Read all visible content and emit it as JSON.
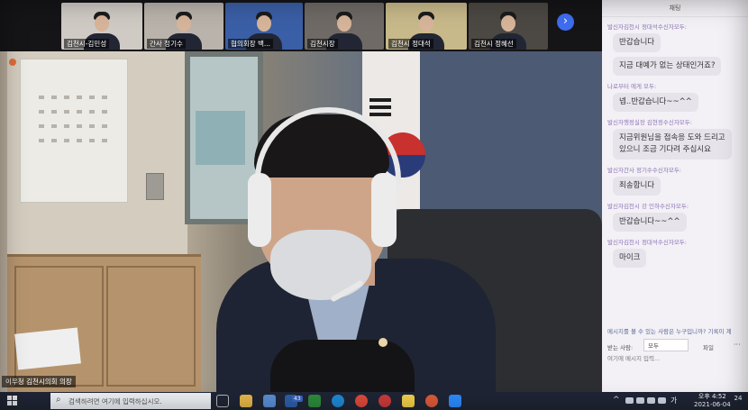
{
  "participants": [
    {
      "label": "김천시-김민성"
    },
    {
      "label": "간사 정기수"
    },
    {
      "label": "협의회장 백..."
    },
    {
      "label": "김천시장"
    },
    {
      "label": "김천시 정대석"
    },
    {
      "label": "김천시 정혜선"
    }
  ],
  "next_icon": "chevron-right-icon",
  "speaker_name": "이우청 김천시의회 의장",
  "chat": {
    "header": "채팅",
    "messages": [
      {
        "sender": "발신자김천시 정대석수신자모두:",
        "text": "반갑습니다"
      },
      {
        "sender": "",
        "text": "지금 대예가 없는 상태인거죠?"
      },
      {
        "sender": "나로부터 에게 모두:",
        "text": "넵..반갑습니다~~^^"
      },
      {
        "sender": "발신자행정실장 김현정수신자모두:",
        "text": "지금위원님을 접속응 도와 드리고 있으니 조금 기다려 주십시요"
      },
      {
        "sender": "발신자간사 정기수수신자모두:",
        "text": "죄송합니다"
      },
      {
        "sender": "발신자김천시 강 인하수신자모두:",
        "text": "반갑습니다~~^^"
      },
      {
        "sender": "발신자김천시 정대석수신자모두:",
        "text": "마이크"
      }
    ],
    "hint": "메시지를 볼 수 있는 사람은 누구입니까? 기록이 계",
    "to_label": "받는 사람:",
    "to_value": "모두",
    "file_label": "파일",
    "more_label": "···",
    "input_placeholder": "여기에 메시지 입력..."
  },
  "taskbar": {
    "search_placeholder": "검색하려면 여기에 입력하십시오.",
    "badge": "43",
    "tray_lang": "가",
    "time": "오후 4:52",
    "date": "2021-06-04",
    "notification_count": "24"
  },
  "colors": {
    "accent": "#3e6df0",
    "chat_sender": "#8d72b8",
    "taskbar": "#1f2535"
  }
}
